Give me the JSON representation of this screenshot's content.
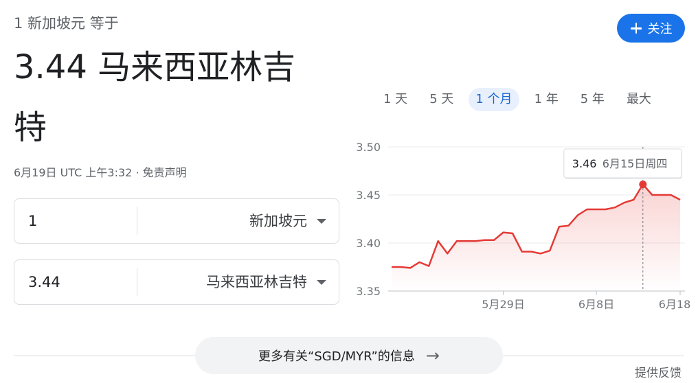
{
  "header": {
    "subtitle": "1 新加坡元 等于",
    "result_line1": "3.44 马来西亚林吉",
    "result_line2": "特",
    "timestamp": "6月19日 UTC 上午3:32 · 免责声明",
    "follow_label": "关注"
  },
  "converter": {
    "from": {
      "value": "1",
      "currency": "新加坡元"
    },
    "to": {
      "value": "3.44",
      "currency": "马来西亚林吉特"
    }
  },
  "ranges": [
    "1 天",
    "5 天",
    "1 个月",
    "1 年",
    "5 年",
    "最大"
  ],
  "active_range": 2,
  "chart_data": {
    "type": "area",
    "ylim": [
      3.35,
      3.5
    ],
    "yticks": [
      3.5,
      3.45,
      3.4,
      3.35
    ],
    "xtick_labels": [
      "5月29日",
      "6月8日",
      "6月18日"
    ],
    "xtick_index": [
      12,
      22,
      31
    ],
    "values": [
      3.375,
      3.375,
      3.374,
      3.38,
      3.376,
      3.402,
      3.389,
      3.402,
      3.402,
      3.402,
      3.403,
      3.403,
      3.411,
      3.41,
      3.391,
      3.391,
      3.389,
      3.392,
      3.417,
      3.418,
      3.429,
      3.435,
      3.435,
      3.435,
      3.437,
      3.442,
      3.445,
      3.461,
      3.45,
      3.45,
      3.45,
      3.445
    ],
    "tooltip": {
      "value": "3.46",
      "date": "6月15日周四",
      "index": 27
    },
    "line_color": "#e53935"
  },
  "footer": {
    "more_info": "更多有关“SGD/MYR”的信息",
    "feedback": "提供反馈"
  }
}
